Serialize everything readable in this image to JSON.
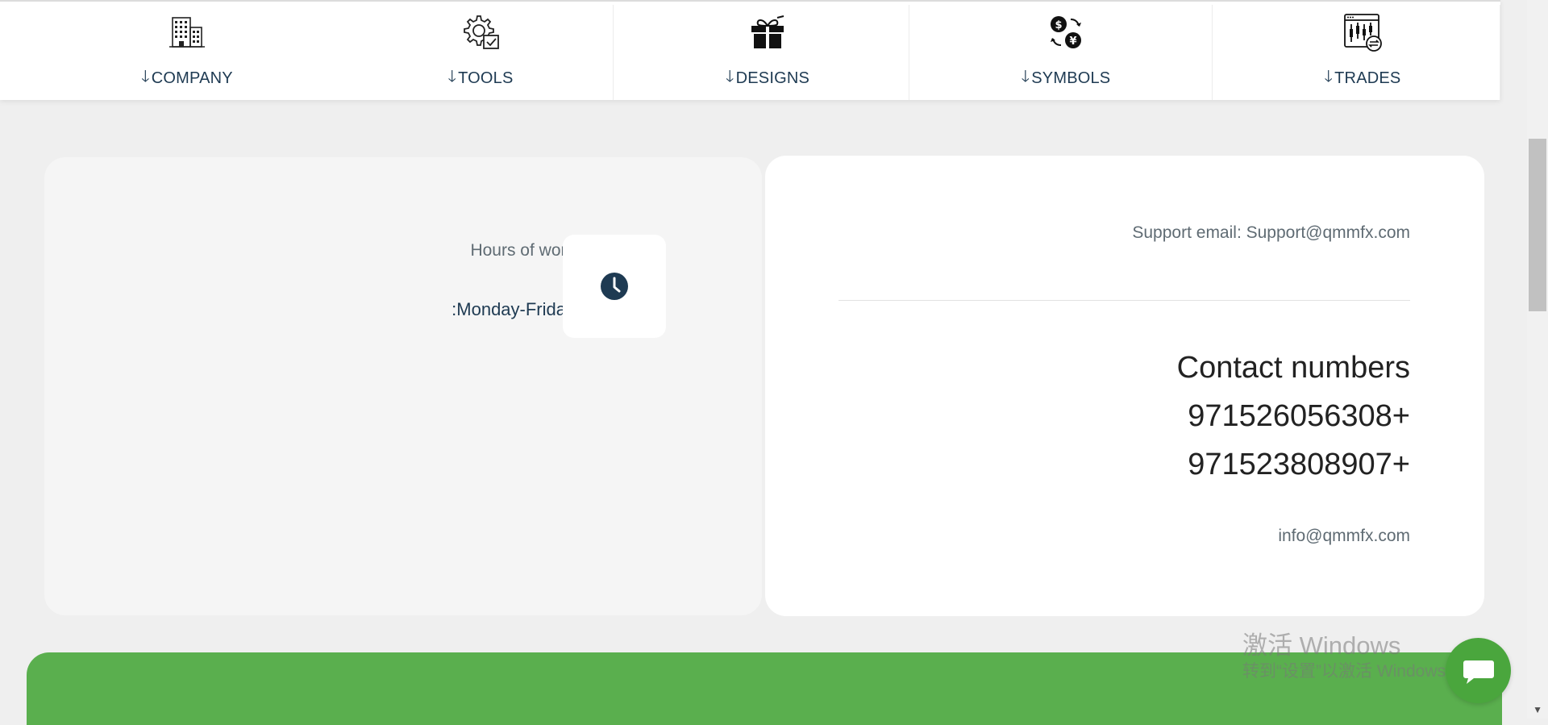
{
  "nav": {
    "items": [
      {
        "label": "COMPANY",
        "icon": "building-icon"
      },
      {
        "label": "TOOLS",
        "icon": "gear-check-icon"
      },
      {
        "label": "DESIGNS",
        "icon": "gift-icon"
      },
      {
        "label": "SYMBOLS",
        "icon": "currency-exchange-icon"
      },
      {
        "label": "TRADES",
        "icon": "candlestick-chart-icon"
      }
    ],
    "arrow": "🡓"
  },
  "hours": {
    "label": "Hours of work",
    "days": ":Monday-Friday"
  },
  "contact": {
    "support_email": "Support email: Support@qmmfx.com",
    "title": "Contact numbers",
    "phones": [
      "971526056308+",
      "971523808907+"
    ],
    "info_email": "info@qmmfx.com"
  },
  "watermark": {
    "line1": "激活 Windows",
    "line2": "转到“设置”以激活 Windows。"
  },
  "colors": {
    "primary": "#1e3a52",
    "green": "#5aaf4e",
    "chat": "#4aa63d"
  }
}
